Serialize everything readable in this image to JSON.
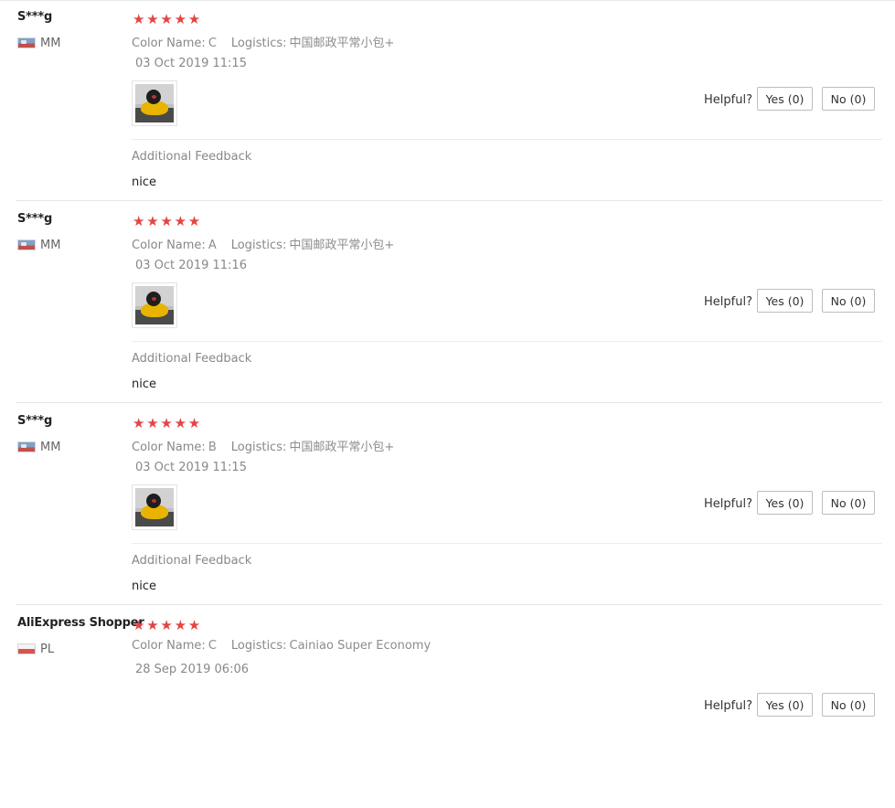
{
  "labels": {
    "color_name": "Color Name:",
    "logistics": "Logistics:",
    "helpful": "Helpful?",
    "additional_feedback": "Additional Feedback"
  },
  "reviews": [
    {
      "user": "S***g",
      "country": "MM",
      "stars": 5,
      "color_name": "C",
      "logistics": "中国邮政平常小包+",
      "date": "03 Oct 2019 11:15",
      "yes": "Yes (0)",
      "no": "No (0)",
      "feedback": "nice"
    },
    {
      "user": "S***g",
      "country": "MM",
      "stars": 5,
      "color_name": "A",
      "logistics": "中国邮政平常小包+",
      "date": "03 Oct 2019 11:16",
      "yes": "Yes (0)",
      "no": "No (0)",
      "feedback": "nice"
    },
    {
      "user": "S***g",
      "country": "MM",
      "stars": 5,
      "color_name": "B",
      "logistics": "中国邮政平常小包+",
      "date": "03 Oct 2019 11:15",
      "yes": "Yes (0)",
      "no": "No (0)",
      "feedback": "nice"
    },
    {
      "user": "AliExpress Shopper",
      "country": "PL",
      "stars": 5,
      "color_name": "C",
      "logistics": "Cainiao Super Economy",
      "date": "28 Sep 2019 06:06",
      "yes": "Yes (0)",
      "no": "No (0)",
      "feedback": ""
    }
  ],
  "colors": {
    "star": "#e44444",
    "muted_text": "#888888",
    "divider": "#e6e6e6"
  },
  "icons": {
    "star": "star-icon",
    "flag_mm": "myanmar-flag-icon",
    "flag_pl": "poland-flag-icon"
  }
}
